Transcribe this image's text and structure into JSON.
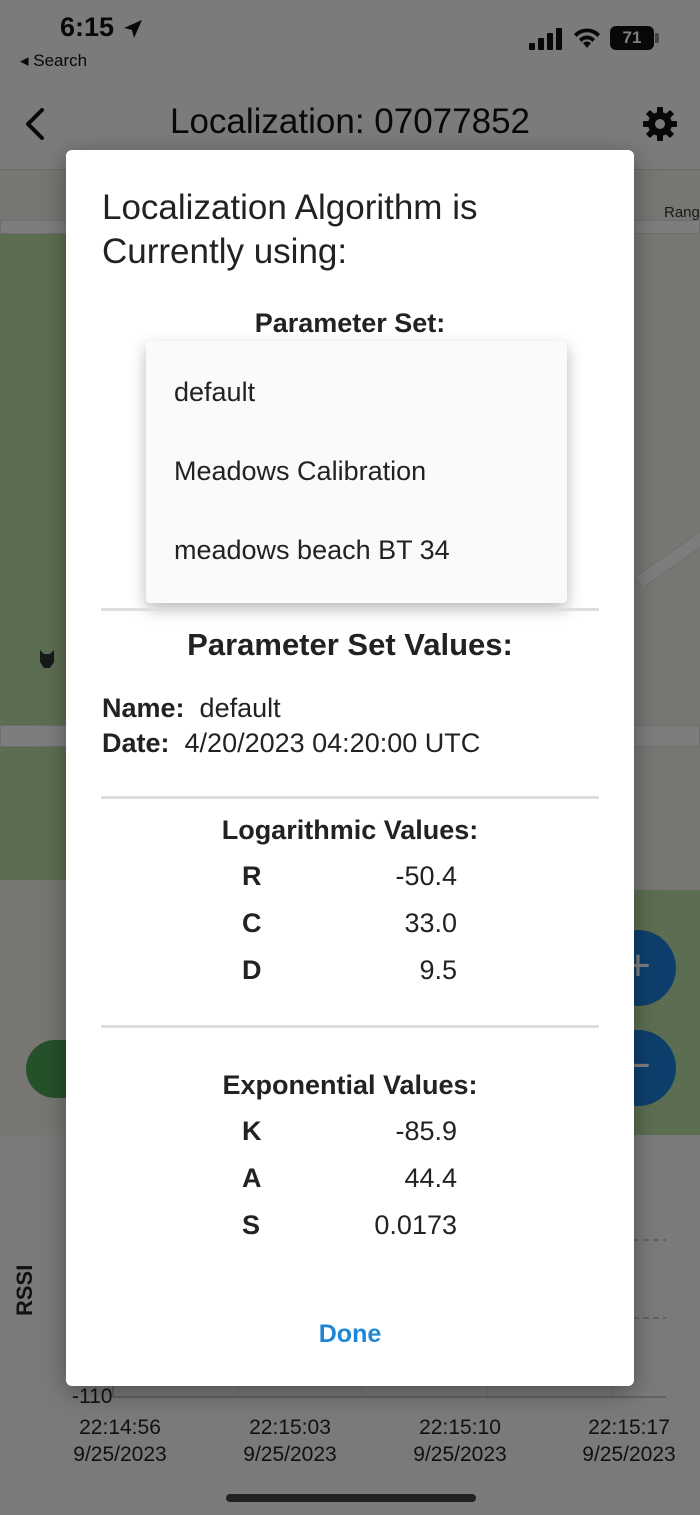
{
  "status_bar": {
    "time": "6:15",
    "back_app_label": "◂ Search",
    "battery": "71"
  },
  "nav": {
    "title": "Localization: 07077852"
  },
  "map": {
    "street_label": "Rang"
  },
  "chart": {
    "ylabel": "RSSI",
    "y_tick_label": "-110",
    "x_ticks": [
      {
        "time": "22:14:56",
        "date": "9/25/2023"
      },
      {
        "time": "22:15:03",
        "date": "9/25/2023"
      },
      {
        "time": "22:15:10",
        "date": "9/25/2023"
      },
      {
        "time": "22:15:17",
        "date": "9/25/2023"
      }
    ]
  },
  "dialog": {
    "title": "Localization Algorithm is Currently using:",
    "parameter_set_label": "Parameter Set:",
    "dropdown_options": [
      "default",
      "Meadows Calibration",
      "meadows beach BT 34"
    ],
    "values_title": "Parameter Set Values:",
    "name_label": "Name:",
    "name_value": "default",
    "date_label": "Date:",
    "date_value": "4/20/2023 04:20:00 UTC",
    "logarithmic": {
      "title": "Logarithmic Values:",
      "rows": [
        {
          "key": "R",
          "value": "-50.4"
        },
        {
          "key": "C",
          "value": "33.0"
        },
        {
          "key": "D",
          "value": "9.5"
        }
      ]
    },
    "exponential": {
      "title": "Exponential Values:",
      "rows": [
        {
          "key": "K",
          "value": "-85.9"
        },
        {
          "key": "A",
          "value": "44.4"
        },
        {
          "key": "S",
          "value": "0.0173"
        }
      ]
    },
    "done_label": "Done"
  }
}
